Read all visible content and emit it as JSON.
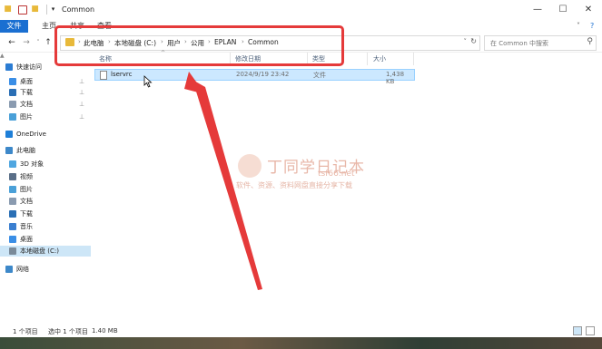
{
  "window": {
    "title": "Common",
    "controls": {
      "minimize": "—",
      "maximize": "☐",
      "close": "✕"
    }
  },
  "ribbon": {
    "tabs": [
      "文件",
      "主页",
      "共享",
      "查看"
    ],
    "expand_glyph": "˅",
    "help_glyph": "?"
  },
  "address": {
    "crumbs": [
      "此电脑",
      "本地磁盘 (C:)",
      "用户",
      "公用",
      "EPLAN",
      "Common"
    ],
    "nav_glyphs": {
      "back": "←",
      "forward": "→",
      "recent": "˅",
      "up": "↑"
    },
    "sep_glyph": "›",
    "dropdown_glyph": "˅",
    "refresh_glyph": "↻"
  },
  "search": {
    "placeholder": "在 Common 中搜索",
    "glyph": "⚲"
  },
  "nav_pane": {
    "items": [
      {
        "label": "快速访问",
        "icon": "star-icon",
        "color": "#2b7cd3",
        "pinned": false
      },
      {
        "label": "桌面",
        "icon": "desktop-icon",
        "color": "#3a8ee6",
        "pinned": true
      },
      {
        "label": "下载",
        "icon": "download-icon",
        "color": "#2a6fb5",
        "pinned": true
      },
      {
        "label": "文档",
        "icon": "document-icon",
        "color": "#8a9bb0",
        "pinned": true
      },
      {
        "label": "图片",
        "icon": "picture-icon",
        "color": "#4aa0d8",
        "pinned": true
      },
      {
        "label": "OneDrive",
        "icon": "cloud-icon",
        "color": "#1e7fd8",
        "pinned": false
      },
      {
        "label": "此电脑",
        "icon": "computer-icon",
        "color": "#3d88c9",
        "pinned": false
      },
      {
        "label": "3D 对象",
        "icon": "cube-icon",
        "color": "#4fa6e0",
        "pinned": false
      },
      {
        "label": "视频",
        "icon": "video-icon",
        "color": "#5a6f88",
        "pinned": false
      },
      {
        "label": "图片",
        "icon": "picture-icon",
        "color": "#4aa0d8",
        "pinned": false
      },
      {
        "label": "文档",
        "icon": "document-icon",
        "color": "#8a9bb0",
        "pinned": false
      },
      {
        "label": "下载",
        "icon": "download-icon",
        "color": "#2a6fb5",
        "pinned": false
      },
      {
        "label": "音乐",
        "icon": "music-icon",
        "color": "#3b7fd0",
        "pinned": false
      },
      {
        "label": "桌面",
        "icon": "desktop-icon",
        "color": "#3a8ee6",
        "pinned": false
      },
      {
        "label": "本地磁盘 (C:)",
        "icon": "drive-icon",
        "color": "#7a8a99",
        "pinned": false
      },
      {
        "label": "网络",
        "icon": "network-icon",
        "color": "#3d88c9",
        "pinned": false
      }
    ],
    "pin_glyph": "⊥"
  },
  "file_list": {
    "columns": [
      "名称",
      "修改日期",
      "类型",
      "大小"
    ],
    "sort_glyph": "^",
    "rows": [
      {
        "name": "lservrc",
        "modified": "2024/9/19 23:42",
        "type": "文件",
        "size": "1,438 KB"
      }
    ]
  },
  "watermark": {
    "title": "丁同学日记本",
    "url": "tsf66.net",
    "subtitle": "软件、资源、资料网盘直接分享下载"
  },
  "status": {
    "count": "1 个项目",
    "selected": "选中 1 个项目",
    "size": "1.40 MB"
  },
  "colors": {
    "accent": "#1a6fd1",
    "highlight_red": "#e53a3a",
    "selection": "#cce8ff"
  }
}
